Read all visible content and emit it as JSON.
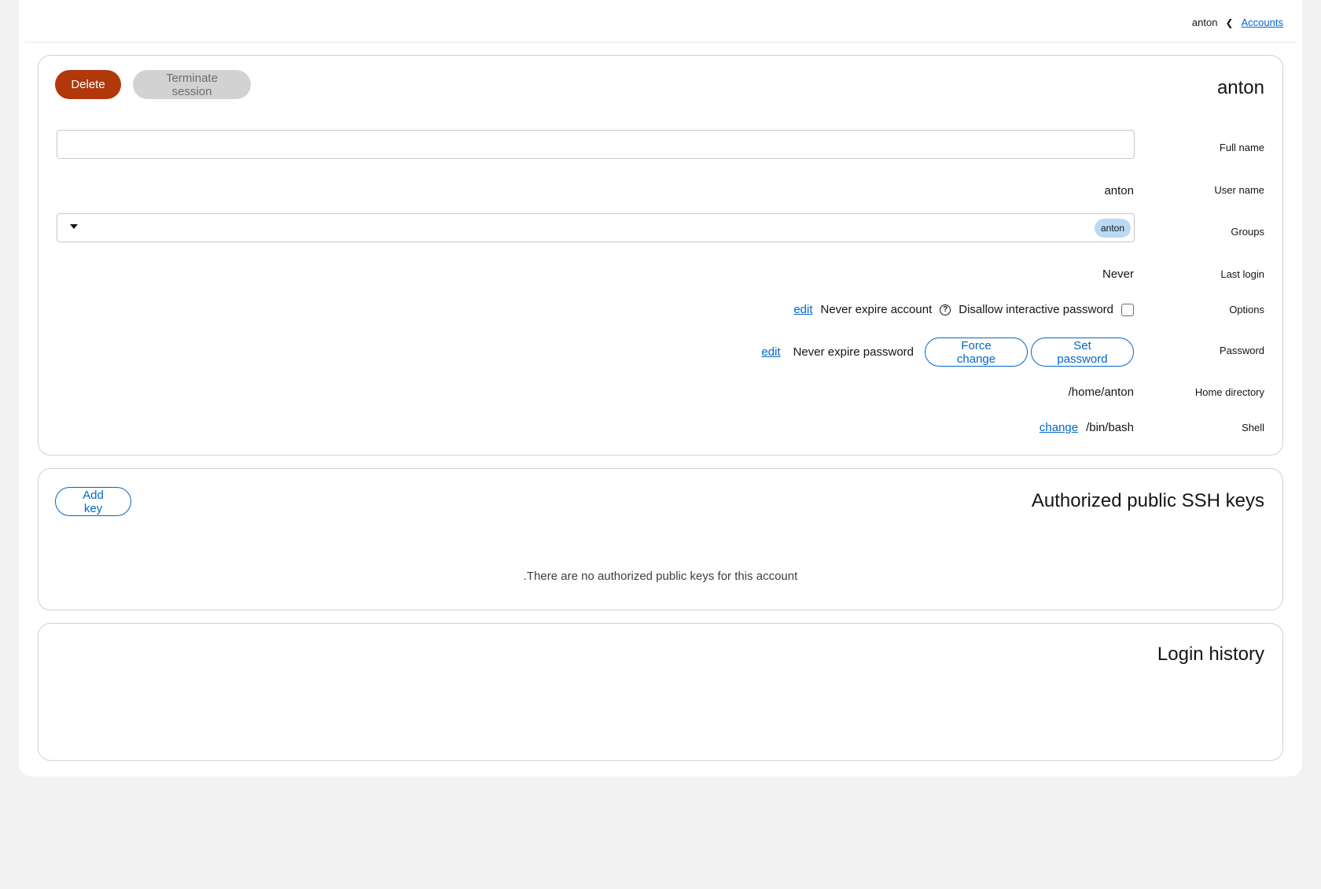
{
  "breadcrumb": {
    "current": "anton",
    "parent": "Accounts"
  },
  "account": {
    "title": "anton",
    "delete_label": "Delete",
    "terminate_label": "Terminate session",
    "rows": {
      "full_name": {
        "label": "Full name",
        "value": ""
      },
      "user_name": {
        "label": "User name",
        "value": "anton"
      },
      "groups": {
        "label": "Groups",
        "chips": [
          "anton"
        ]
      },
      "last_login": {
        "label": "Last login",
        "value": "Never"
      },
      "options": {
        "label": "Options",
        "edit_label": "edit",
        "expire_text": "Never expire account",
        "disallow_label": "Disallow interactive password",
        "help_glyph": "?"
      },
      "password": {
        "label": "Password",
        "edit_label": "edit",
        "expire_text": "Never expire password",
        "force_change_label": "Force change",
        "set_password_label": "Set password"
      },
      "home_directory": {
        "label": "Home directory",
        "value": "/home/anton"
      },
      "shell": {
        "label": "Shell",
        "change_label": "change",
        "value": "/bin/bash"
      }
    }
  },
  "ssh_keys": {
    "title": "Authorized public SSH keys",
    "add_key_label": "Add key",
    "empty_text": ".There are no authorized public keys for this account"
  },
  "login_history": {
    "title": "Login history"
  },
  "colors": {
    "danger": "#b1380b",
    "link": "#0066cc",
    "chip": "#b9d9f5",
    "disabled": "#d2d2d2"
  }
}
